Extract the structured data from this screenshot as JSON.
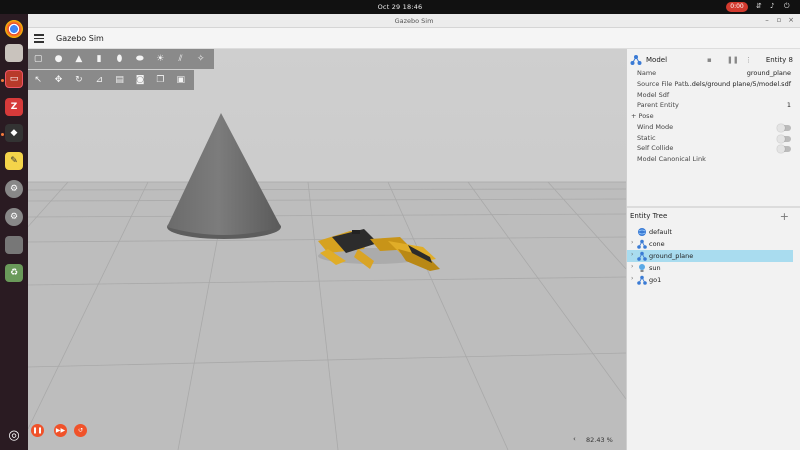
{
  "system": {
    "clock": "Oct 29  18:46",
    "recording": "0:00",
    "tray": [
      "network-icon",
      "volume-icon",
      "power-icon"
    ]
  },
  "window": {
    "title": "Gazebo Sim"
  },
  "app": {
    "title": "Gazebo Sim"
  },
  "dock": [
    "chrome-icon",
    "files-icon",
    "terminal-icon",
    "zotero-icon",
    "box-icon",
    "notes-icon",
    "settings-icon",
    "settings-icon",
    "trash-icon",
    "recycle-icon",
    "ubuntu-icon"
  ],
  "toolbar_shapes": [
    "box-icon",
    "sphere-icon",
    "cone-icon",
    "cylinder-icon",
    "capsule-icon",
    "ellipsoid-icon",
    "sun-icon",
    "directional-light-icon",
    "spot-light-icon"
  ],
  "toolbar_transform": [
    "select-icon",
    "translate-icon",
    "rotate-icon",
    "snap-icon",
    "grid-icon",
    "screenshot-icon",
    "copy-icon",
    "paste-icon"
  ],
  "playback": {
    "rtf": "82.43 %"
  },
  "component_inspector": {
    "title": "Model",
    "entity": "Entity 8",
    "rows": [
      {
        "key": "Name",
        "value": "ground_plane"
      },
      {
        "key": "Source File Path",
        "value": "...dels/ground plane/5/model.sdf"
      },
      {
        "key": "Model Sdf",
        "value": ""
      },
      {
        "key": "Parent Entity",
        "value": "1"
      }
    ],
    "pose_label": "+ Pose",
    "toggles": [
      {
        "key": "Wind Mode"
      },
      {
        "key": "Static"
      },
      {
        "key": "Self Collide"
      }
    ],
    "canonical_link": "Model Canonical Link"
  },
  "entity_tree": {
    "title": "Entity Tree",
    "add_label": "+",
    "items": [
      {
        "label": "default",
        "icon": "world-icon",
        "arrow": ""
      },
      {
        "label": "cone",
        "icon": "model-icon",
        "arrow": "›"
      },
      {
        "label": "ground_plane",
        "icon": "model-icon",
        "arrow": "›",
        "selected": true
      },
      {
        "label": "sun",
        "icon": "light-icon",
        "arrow": "›"
      },
      {
        "label": "go1",
        "icon": "model-icon",
        "arrow": "›"
      }
    ]
  }
}
